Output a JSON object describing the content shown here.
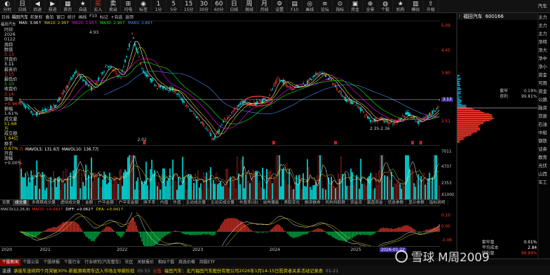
{
  "toolbar": {
    "buttons": [
      {
        "icon": "◐",
        "label": "分时",
        "red": false
      },
      {
        "icon": "日",
        "label": "日线",
        "red": false
      },
      {
        "icon": "◀",
        "label": "后退",
        "red": false
      },
      {
        "icon": "▶",
        "label": "前进",
        "red": false
      },
      {
        "icon": "▦",
        "label": "首页",
        "red": false
      },
      {
        "icon": "★",
        "label": "自选",
        "red": false
      },
      {
        "icon": "买",
        "label": "买入",
        "red": true
      },
      {
        "icon": "卖",
        "label": "卖出",
        "red": false
      },
      {
        "icon": "⊞",
        "label": "闪电",
        "red": false
      },
      {
        "icon": "◉",
        "label": "标签",
        "red": false
      },
      {
        "icon": "1",
        "label": "1分",
        "red": false
      },
      {
        "icon": "5",
        "label": "5分",
        "red": false
      },
      {
        "icon": "15",
        "label": "15分",
        "red": false
      },
      {
        "icon": "30",
        "label": "30分",
        "red": false
      },
      {
        "icon": "60",
        "label": "60分",
        "red": false
      },
      {
        "icon": "日",
        "label": "日线",
        "red": false
      },
      {
        "icon": "周",
        "label": "周线",
        "red": false
      },
      {
        "icon": "月",
        "label": "月线",
        "red": false
      },
      {
        "icon": "⚙",
        "label": "设置",
        "red": false
      },
      {
        "icon": "▤",
        "label": "F10",
        "red": false
      },
      {
        "icon": "◎",
        "label": "画线",
        "red": false
      },
      {
        "icon": "≡",
        "label": "论坛",
        "red": false
      },
      {
        "icon": "⊙",
        "label": "指标",
        "red": false
      },
      {
        "icon": "▣",
        "label": "资金",
        "red": false
      },
      {
        "icon": "⊕",
        "label": "全景",
        "red": false
      },
      {
        "icon": "◍",
        "label": "个股",
        "red": false
      },
      {
        "icon": "★",
        "label": "机构",
        "red": false
      },
      {
        "icon": "▥",
        "label": "模拟",
        "red": false
      },
      {
        "icon": "⇧",
        "label": "升级",
        "red": false
      }
    ],
    "right_text": "汽车"
  },
  "infostrip": {
    "period": "日线",
    "stock_name": "福田汽车",
    "items": [
      "前复权",
      "叠加",
      "窗口",
      "统计",
      "画线",
      "F10",
      "标记",
      "+自选",
      "返回"
    ]
  },
  "ma_legend": {
    "name": "福田汽车",
    "ma5": "MA5: 3.06↑",
    "ma10": "MA10: 2.99↑",
    "ma20": "MA20: 2.95↑",
    "ma30": "MA30: 2.90↑",
    "ma60": "MA60: 2.88↑"
  },
  "left_data": [
    {
      "label": "时间",
      "value": "2026",
      "color": "#ccc"
    },
    {
      "label": "",
      "value": "0122",
      "color": "#ccc"
    },
    {
      "label": "",
      "value": "周四",
      "color": "#ccc"
    },
    {
      "label": "数值",
      "value": "",
      "color": "#ccc"
    },
    {
      "label": "",
      "value": "3.13",
      "color": "#ff3b30"
    },
    {
      "label": "开盘价",
      "value": "",
      "color": "#ccc"
    },
    {
      "label": "",
      "value": "3.11",
      "color": "#fff"
    },
    {
      "label": "最高价",
      "value": "",
      "color": "#ccc"
    },
    {
      "label": "",
      "value": "3.15",
      "color": "#ff3b30"
    },
    {
      "label": "最低价",
      "value": "",
      "color": "#ccc"
    },
    {
      "label": "",
      "value": "3.10",
      "color": "#2ecc40"
    },
    {
      "label": "收盘价",
      "value": "",
      "color": "#ccc"
    },
    {
      "label": "",
      "value": "3.14",
      "color": "#ff3b30"
    },
    {
      "label": "涨幅",
      "value": "",
      "color": "#ccc"
    },
    {
      "label": "",
      "value": "+0.96%",
      "color": "#ff3b30"
    },
    {
      "label": "振幅",
      "value": "",
      "color": "#ccc"
    },
    {
      "label": "",
      "value": "1.61%",
      "color": "#ccc"
    },
    {
      "label": "成交量",
      "value": "",
      "color": "#ccc"
    },
    {
      "label": "",
      "value": "51.68万",
      "color": "#e8d700"
    },
    {
      "label": "成交额",
      "value": "",
      "color": "#ccc"
    },
    {
      "label": "",
      "value": "1.64亿",
      "color": "#e8d700"
    },
    {
      "label": "换手",
      "value": "",
      "color": "#ccc"
    },
    {
      "label": "",
      "value": "0.67%",
      "color": "#e8d700"
    },
    {
      "label": "开盘",
      "value": "",
      "color": "#ccc"
    },
    {
      "label": "涨幅",
      "value": "",
      "color": "#ccc"
    },
    {
      "label": "",
      "value": "+0.00%",
      "color": "#ccc"
    }
  ],
  "price_annotations": {
    "high_label": "4.93",
    "low_label": "2.02",
    "recent_low_label": "2.35-2.36"
  },
  "price_axis": [
    "5.09",
    "4.45",
    "3.80",
    "3.13",
    "2.51"
  ],
  "price_axis_current": "3.13",
  "vol_legend": {
    "prefix": "万",
    "mavol5": "MAVOL5: 131.6万",
    "mavol10": "MAVOL10: 136.7万"
  },
  "vol_axis": [
    "7011",
    "4707",
    "2353",
    "X1000"
  ],
  "indicator_tabs": [
    "设置",
    "成交量",
    "多周期成交量",
    "虚拟成交量",
    "金额",
    "户平金额",
    "户平变金额",
    "换手率",
    "内盘",
    "外盘",
    "主动成交量",
    "主动买成交量",
    "市盈率(动)",
    "结构量能",
    "换股变化",
    "融资融券",
    "机构持股数",
    "资金流",
    "赢盘资金",
    "优选参数",
    "显示参数",
    "指标说明"
  ],
  "indicator_active": "成交量",
  "macd_label": {
    "name": "MACD(12,26,9)",
    "macd": "MACD: +0.043↑",
    "diff": "DIFF: +0.062↑",
    "dea": "DEA: +0.041↑"
  },
  "macd_axis": [
    "0.10",
    "0.00",
    "-0.08"
  ],
  "date_axis": [
    "2020",
    "2021",
    "2022",
    "2023",
    "2024",
    "2025",
    "2026-01-22"
  ],
  "bottom_tabs": [
    "个股新闻",
    "个股公告",
    "个股研报",
    "个股行业",
    "行业研究(汽车整车)",
    "社区",
    "关联报价",
    "相似个股",
    "商品价格",
    "持股ETF"
  ],
  "bottom_active": "个股新闻",
  "status": {
    "left_text": "凌通",
    "news_left": "承接车连续四个月突破30% 新能源商用车迈入市场主导新阶段",
    "time_left": "05:53",
    "ann_tag": "公告",
    "news_right": "福田汽车：北汽福田汽车股份有限公司2026年1月14-15日投资者关系活动记录表",
    "time_right": "01-21"
  },
  "right_panel": {
    "stock_name": "福田汽车",
    "code": "600166",
    "hist_labels": [
      {
        "label": "套牢",
        "value": "0.19%"
      },
      {
        "label": "获利",
        "value": "99.81%"
      }
    ],
    "current_price": "3.13",
    "cost_rows": [
      {
        "label": "套牢盘",
        "value": "0.19%"
      },
      {
        "label": "平均成本",
        "value": "2.84"
      },
      {
        "label": "获利盘",
        "value": "99.99%"
      }
    ],
    "bottom_rows": [
      {
        "label": "套牢盘",
        "value": "0.01%"
      },
      {
        "label": "平均成本",
        "value": "2.84"
      },
      {
        "label": "获利盘",
        "value": "99.99%"
      }
    ]
  },
  "far_right": [
    "主力",
    "主力",
    "主力",
    "净特",
    "净大",
    "净中",
    "净小",
    "资金",
    "可用",
    "资金",
    "公路",
    "融资",
    "贷款",
    "石油",
    "中船",
    "钢铁",
    "证券",
    "教育",
    "光伏",
    "山西",
    "军工"
  ],
  "watermark": {
    "brand": "雪球",
    "user": "M周2009"
  },
  "colors": {
    "up": "#ff3b30",
    "down": "#00d7d7",
    "ma5": "#ffffff",
    "ma10": "#e8d700",
    "ma20": "#ff00ff",
    "ma30": "#00ff00",
    "ma60": "#4a90ff",
    "bg": "#000000"
  }
}
